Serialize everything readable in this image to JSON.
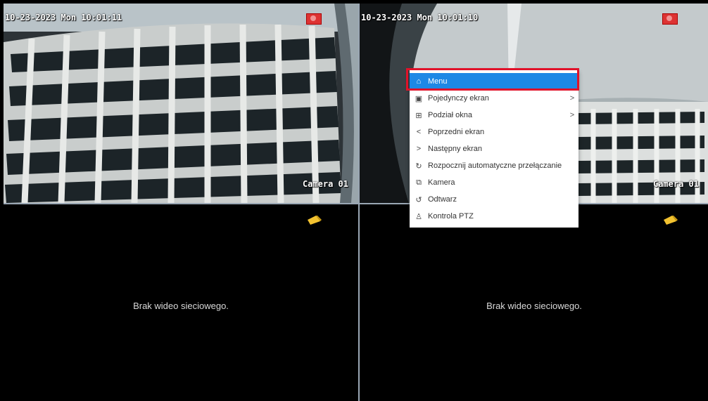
{
  "tiles": [
    {
      "timestamp": "10-23-2023 Mon 10:01:11",
      "camera": "Camera 01"
    },
    {
      "timestamp": "10-23-2023 Mon 10:01:10",
      "camera": "Camera 01"
    },
    {
      "no_video": "Brak wideo sieciowego."
    },
    {
      "no_video": "Brak wideo sieciowego."
    }
  ],
  "menu": {
    "items": [
      {
        "icon": "home-icon",
        "label": "Menu",
        "submenu": false
      },
      {
        "icon": "single-screen-icon",
        "label": "Pojedynczy ekran",
        "submenu": true
      },
      {
        "icon": "grid-icon",
        "label": "Podział okna",
        "submenu": true
      },
      {
        "icon": "chevron-left-icon",
        "label": "Poprzedni ekran",
        "submenu": false
      },
      {
        "icon": "chevron-right-icon",
        "label": "Następny ekran",
        "submenu": false
      },
      {
        "icon": "cycle-icon",
        "label": "Rozpocznij automatyczne przełączanie",
        "submenu": false
      },
      {
        "icon": "camera-icon",
        "label": "Kamera",
        "submenu": false
      },
      {
        "icon": "playback-icon",
        "label": "Odtwarz",
        "submenu": false
      },
      {
        "icon": "ptz-user-icon",
        "label": "Kontrola PTZ",
        "submenu": false
      }
    ],
    "active_index": 0,
    "accent_color": "#1e88e5",
    "highlight_color": "#e1122a"
  },
  "colors": {
    "recording_badge": "#d33333",
    "alarm_bell": "#f2c230"
  }
}
